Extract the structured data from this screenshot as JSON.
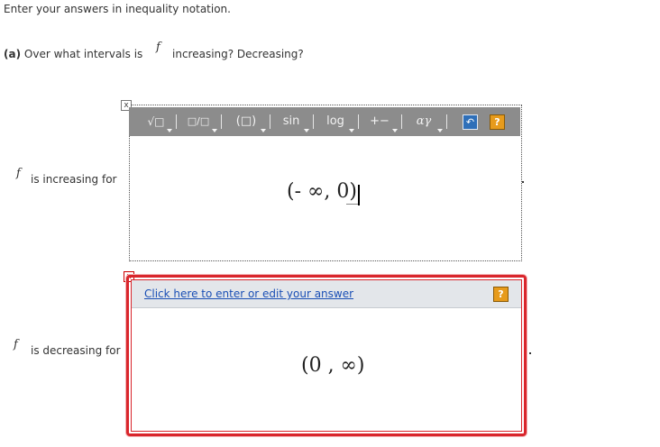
{
  "instruction": "Enter your answers in inequality notation.",
  "question": {
    "label": "(a)",
    "prefix": "Over what intervals is",
    "func": "f",
    "suffix": "increasing? Decreasing?"
  },
  "increasing": {
    "func": "f",
    "label": "is increasing for",
    "answer": "(- ∞, 0)",
    "close_symbol": "x"
  },
  "toolbar": {
    "items": [
      {
        "name": "radical-template",
        "label": "√□"
      },
      {
        "name": "fraction-template",
        "label": "□/□"
      },
      {
        "name": "parentheses-template",
        "label": "(□)"
      },
      {
        "name": "trig-functions",
        "label": "sin"
      },
      {
        "name": "log-functions",
        "label": "log"
      },
      {
        "name": "operators",
        "label": "+−"
      },
      {
        "name": "greek-letters",
        "label": "αγ"
      }
    ],
    "undo_label": "↶",
    "help_label": "?"
  },
  "decreasing": {
    "func": "f",
    "label": "is decreasing for",
    "link_text": "Click here to enter or edit your answer",
    "answer": "(0 , ∞)",
    "help_label": "?",
    "close_symbol": "x"
  },
  "colors": {
    "toolbar_bg": "#8c8c8c",
    "error_border": "#d9262c",
    "link": "#1a4fb5",
    "help_button": "#e79b1c",
    "undo_button": "#2f6fb8"
  }
}
